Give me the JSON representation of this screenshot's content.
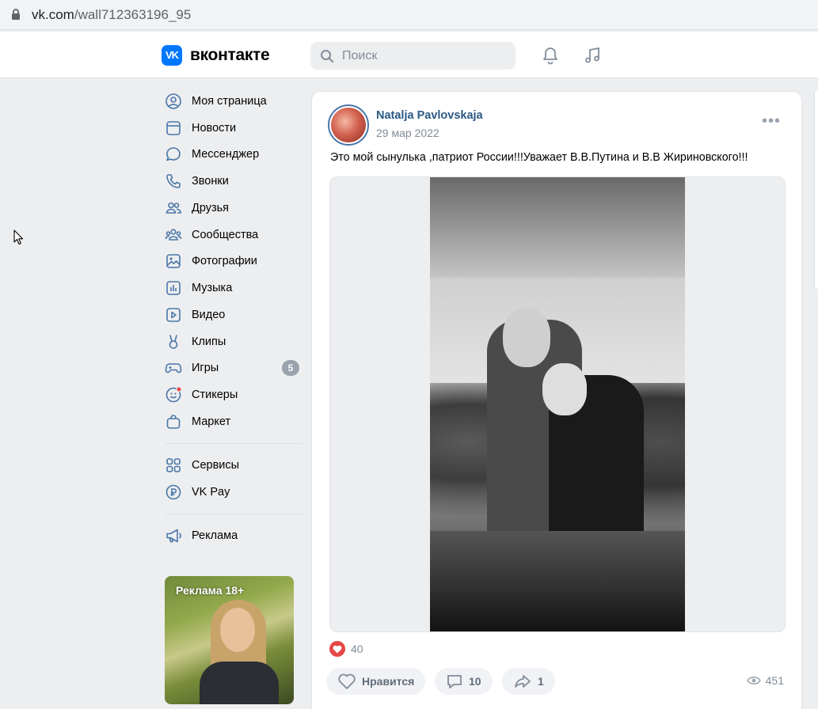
{
  "browser": {
    "url_domain": "vk.com",
    "url_path": "/wall712363196_95"
  },
  "header": {
    "logo_mark": "VK",
    "logo_text": "вконтакте",
    "search_placeholder": "Поиск",
    "brand_color": "#0077ff"
  },
  "sidebar": {
    "items": [
      {
        "label": "Моя страница",
        "icon": "profile-icon"
      },
      {
        "label": "Новости",
        "icon": "news-icon"
      },
      {
        "label": "Мессенджер",
        "icon": "messenger-icon"
      },
      {
        "label": "Звонки",
        "icon": "phone-icon"
      },
      {
        "label": "Друзья",
        "icon": "friends-icon"
      },
      {
        "label": "Сообщества",
        "icon": "communities-icon"
      },
      {
        "label": "Фотографии",
        "icon": "photos-icon"
      },
      {
        "label": "Музыка",
        "icon": "music-icon"
      },
      {
        "label": "Видео",
        "icon": "video-icon"
      },
      {
        "label": "Клипы",
        "icon": "clips-icon"
      },
      {
        "label": "Игры",
        "icon": "games-icon",
        "badge": "5"
      },
      {
        "label": "Стикеры",
        "icon": "stickers-icon"
      },
      {
        "label": "Маркет",
        "icon": "market-icon"
      },
      {
        "label": "Сервисы",
        "icon": "services-icon"
      },
      {
        "label": "VK Pay",
        "icon": "vkpay-icon"
      },
      {
        "label": "Реклама",
        "icon": "ads-icon"
      }
    ],
    "ad_label": "Реклама 18+"
  },
  "post": {
    "author": "Natalja Pavlovskaja",
    "date": "29 мар 2022",
    "text": "Это мой сынулька ,патриот России!!!Уважает В.В.Путина и В.В Жириновского!!!",
    "likes_count": "40",
    "like_label": "Нравится",
    "comments_count": "10",
    "shares_count": "1",
    "views_count": "451"
  }
}
